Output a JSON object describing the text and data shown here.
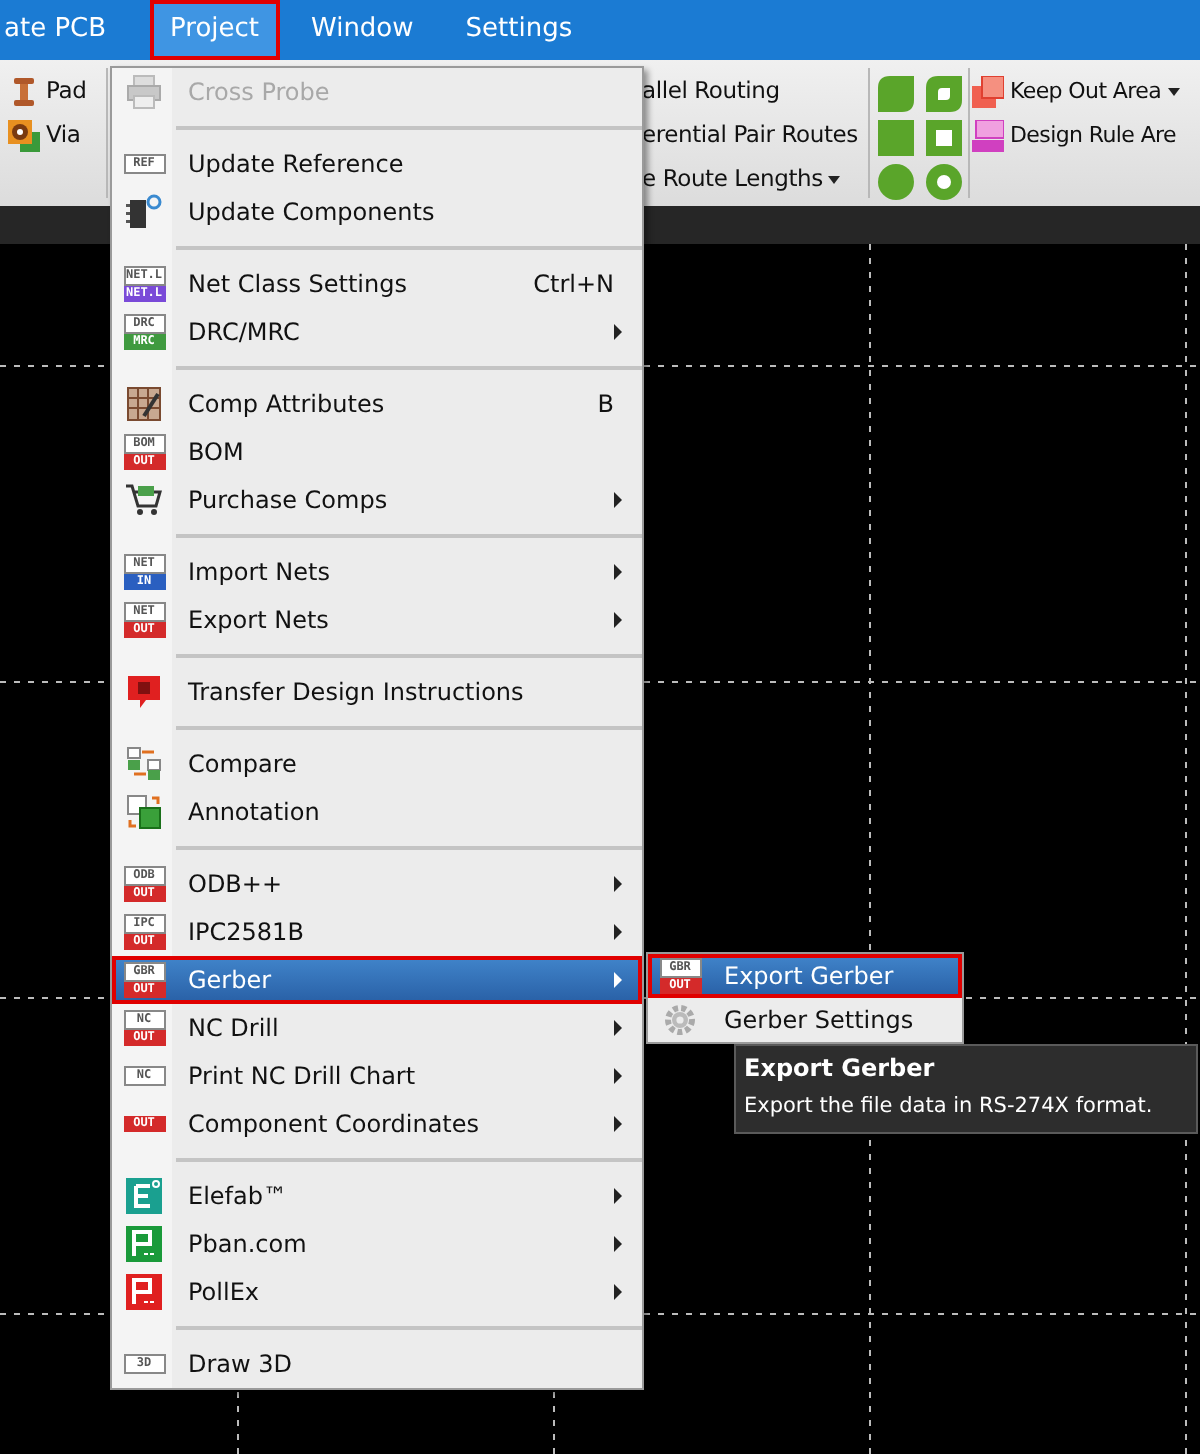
{
  "menu_bar": [
    {
      "label": "ate PCB",
      "selected": false,
      "highlighted": false
    },
    {
      "label": "Project",
      "selected": true,
      "highlighted": true
    },
    {
      "label": "Window",
      "selected": false,
      "highlighted": false
    },
    {
      "label": "Settings",
      "selected": false,
      "highlighted": false
    }
  ],
  "toolbar": {
    "left": [
      {
        "label": "Pad"
      },
      {
        "label": "Via"
      }
    ],
    "routing": [
      {
        "label": "allel Routing",
        "dropdown": false
      },
      {
        "label": "erential Pair Routes",
        "dropdown": false
      },
      {
        "label": "e Route Lengths",
        "dropdown": true
      }
    ],
    "areas": [
      {
        "label": "Keep Out Area",
        "dropdown": true
      },
      {
        "label": "Design Rule Are",
        "dropdown": false
      }
    ]
  },
  "project_menu": [
    {
      "kind": "item",
      "label": "Cross Probe",
      "disabled": true,
      "submenu": false,
      "selected": false,
      "highlighted": false
    },
    {
      "kind": "separator"
    },
    {
      "kind": "item",
      "label": "Update Reference",
      "badge": {
        "top": "REF"
      },
      "disabled": false,
      "submenu": false,
      "selected": false,
      "highlighted": false
    },
    {
      "kind": "item",
      "label": "Update Components",
      "disabled": false,
      "submenu": false,
      "selected": false,
      "highlighted": false
    },
    {
      "kind": "separator"
    },
    {
      "kind": "item",
      "label": "Net Class Settings",
      "shortcut": "Ctrl+N",
      "badge": {
        "top": "NET.L",
        "bottom": "NET.L",
        "color": "#7a4ad8"
      },
      "disabled": false,
      "submenu": false,
      "selected": false,
      "highlighted": false
    },
    {
      "kind": "item",
      "label": "DRC/MRC",
      "badge": {
        "top": "DRC",
        "bottom": "MRC",
        "color": "#3f9a3f"
      },
      "disabled": false,
      "submenu": true,
      "selected": false,
      "highlighted": false
    },
    {
      "kind": "separator"
    },
    {
      "kind": "item",
      "label": "Comp Attributes",
      "shortcut": "B",
      "disabled": false,
      "submenu": false,
      "selected": false,
      "highlighted": false
    },
    {
      "kind": "item",
      "label": "BOM",
      "badge": {
        "top": "BOM",
        "bottom": "OUT",
        "color": "#d42a2a"
      },
      "disabled": false,
      "submenu": false,
      "selected": false,
      "highlighted": false
    },
    {
      "kind": "item",
      "label": "Purchase Comps",
      "disabled": false,
      "submenu": true,
      "selected": false,
      "highlighted": false
    },
    {
      "kind": "separator"
    },
    {
      "kind": "item",
      "label": "Import Nets",
      "badge": {
        "top": "NET",
        "bottom": "IN",
        "color": "#2a5fc0"
      },
      "disabled": false,
      "submenu": true,
      "selected": false,
      "highlighted": false
    },
    {
      "kind": "item",
      "label": "Export Nets",
      "badge": {
        "top": "NET",
        "bottom": "OUT",
        "color": "#d42a2a"
      },
      "disabled": false,
      "submenu": true,
      "selected": false,
      "highlighted": false
    },
    {
      "kind": "separator"
    },
    {
      "kind": "item",
      "label": "Transfer Design Instructions",
      "disabled": false,
      "submenu": false,
      "selected": false,
      "highlighted": false
    },
    {
      "kind": "separator"
    },
    {
      "kind": "item",
      "label": "Compare",
      "disabled": false,
      "submenu": false,
      "selected": false,
      "highlighted": false
    },
    {
      "kind": "item",
      "label": "Annotation",
      "disabled": false,
      "submenu": false,
      "selected": false,
      "highlighted": false
    },
    {
      "kind": "separator"
    },
    {
      "kind": "item",
      "label": "ODB++",
      "badge": {
        "top": "ODB",
        "bottom": "OUT",
        "color": "#d42a2a"
      },
      "disabled": false,
      "submenu": true,
      "selected": false,
      "highlighted": false
    },
    {
      "kind": "item",
      "label": "IPC2581B",
      "badge": {
        "top": "IPC",
        "bottom": "OUT",
        "color": "#d42a2a"
      },
      "disabled": false,
      "submenu": true,
      "selected": false,
      "highlighted": false
    },
    {
      "kind": "item",
      "label": "Gerber",
      "badge": {
        "top": "GBR",
        "bottom": "OUT",
        "color": "#d42a2a"
      },
      "disabled": false,
      "submenu": true,
      "selected": true,
      "highlighted": true
    },
    {
      "kind": "item",
      "label": "NC Drill",
      "badge": {
        "top": "NC",
        "bottom": "OUT",
        "color": "#d42a2a"
      },
      "disabled": false,
      "submenu": true,
      "selected": false,
      "highlighted": false
    },
    {
      "kind": "item",
      "label": "Print NC Drill Chart",
      "badge": {
        "top": "NC"
      },
      "disabled": false,
      "submenu": true,
      "selected": false,
      "highlighted": false
    },
    {
      "kind": "item",
      "label": "Component Coordinates",
      "badge": {
        "bottom": "OUT",
        "color": "#d42a2a"
      },
      "disabled": false,
      "submenu": true,
      "selected": false,
      "highlighted": false
    },
    {
      "kind": "separator"
    },
    {
      "kind": "item",
      "label": "Elefab™",
      "disabled": false,
      "submenu": true,
      "selected": false,
      "highlighted": false
    },
    {
      "kind": "item",
      "label": "Pban.com",
      "disabled": false,
      "submenu": true,
      "selected": false,
      "highlighted": false
    },
    {
      "kind": "item",
      "label": "PollEx",
      "disabled": false,
      "submenu": true,
      "selected": false,
      "highlighted": false
    },
    {
      "kind": "separator"
    },
    {
      "kind": "item",
      "label": "Draw 3D",
      "badge": {
        "top": "3D"
      },
      "disabled": false,
      "submenu": false,
      "selected": false,
      "highlighted": false
    }
  ],
  "gerber_submenu": [
    {
      "label": "Export Gerber",
      "badge": {
        "top": "GBR",
        "bottom": "OUT",
        "color": "#d42a2a"
      },
      "selected": true,
      "highlighted": true
    },
    {
      "label": "Gerber Settings",
      "selected": false,
      "highlighted": false
    }
  ],
  "tooltip": {
    "title": "Export Gerber",
    "text": "Export the file data in RS-274X format."
  }
}
